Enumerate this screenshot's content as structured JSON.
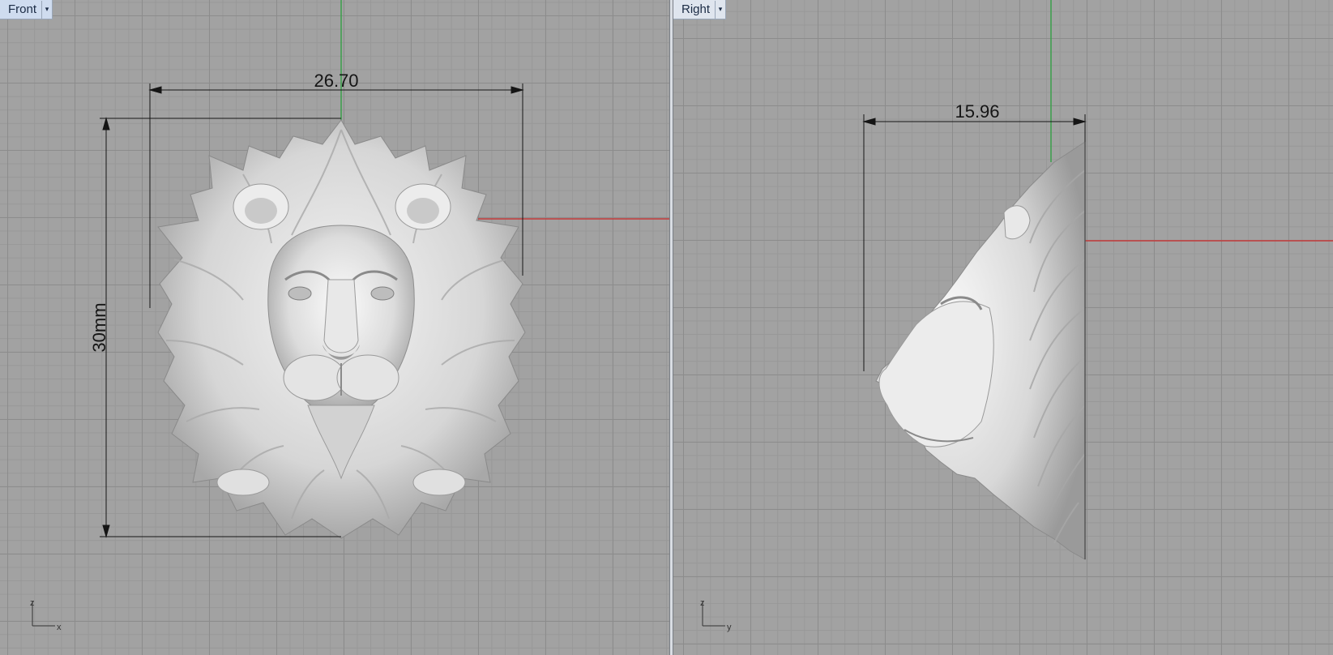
{
  "viewports": {
    "front": {
      "title": "Front",
      "dropdown_icon": "caret-down-icon",
      "dimensions": {
        "width": "26.70",
        "height": "30mm"
      },
      "axes": {
        "vertical": "z",
        "horizontal": "x"
      }
    },
    "right": {
      "title": "Right",
      "dropdown_icon": "caret-down-icon",
      "dimensions": {
        "depth": "15.96"
      },
      "axes": {
        "vertical": "z",
        "horizontal": "y"
      }
    }
  },
  "colors": {
    "background": "#a2a2a2",
    "grid_major": "#8c8c8c",
    "grid_minor": "#989898",
    "x_axis": "#c33a3a",
    "z_axis": "#3aa04a",
    "model": "#e6e6e6"
  }
}
